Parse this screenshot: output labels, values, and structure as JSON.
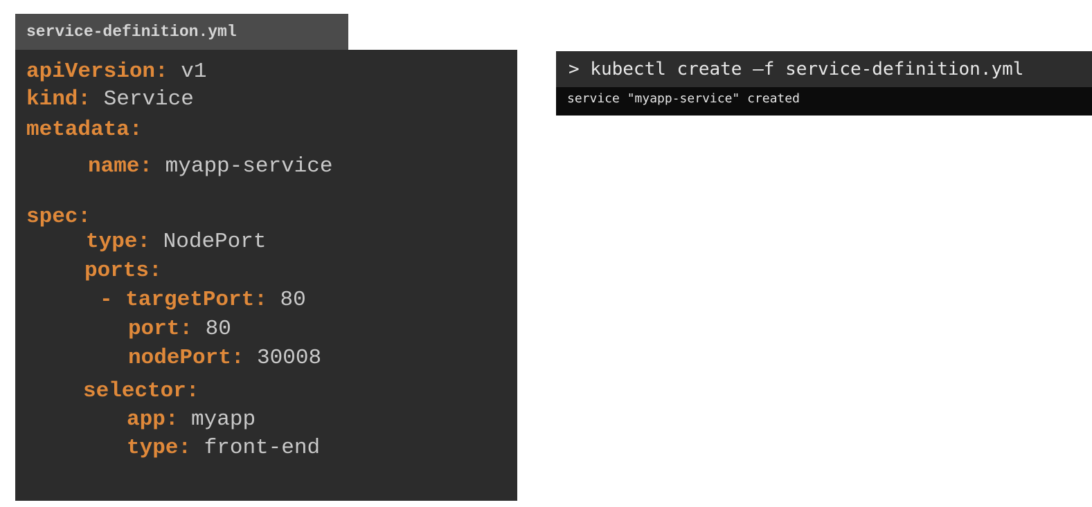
{
  "file_tab": {
    "label": "service-definition.yml"
  },
  "yaml_lines": [
    {
      "key": "apiVersion",
      "value": "v1"
    },
    {
      "key": "kind",
      "value": "Service"
    },
    {
      "key": "metadata",
      "value": ""
    },
    {
      "key": "name",
      "value": "myapp-service"
    },
    {
      "key": "spec",
      "value": ""
    },
    {
      "key": "type",
      "value": "NodePort"
    },
    {
      "key": "ports",
      "value": ""
    },
    {
      "key": "- targetPort",
      "value": "80"
    },
    {
      "key": "port",
      "value": "80"
    },
    {
      "key": "nodePort",
      "value": "30008"
    },
    {
      "key": "selector",
      "value": ""
    },
    {
      "key": "app",
      "value": "myapp"
    },
    {
      "key": "type",
      "value": "front-end"
    }
  ],
  "terminal": {
    "command": "> kubectl create –f service-definition.yml",
    "output": "service \"myapp-service\" created"
  }
}
